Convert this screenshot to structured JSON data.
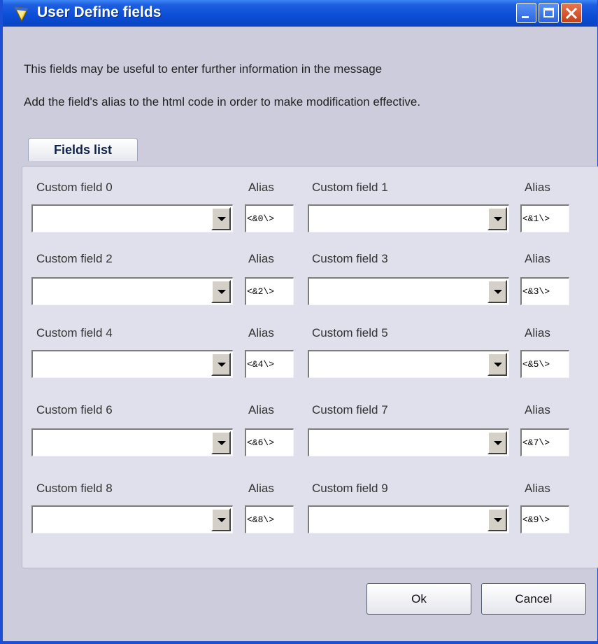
{
  "window": {
    "title": "User Define fields",
    "controls": [
      "minimize-icon",
      "maximize-icon",
      "close-icon"
    ]
  },
  "info": {
    "line1": "This fields may be useful to enter further information in the message",
    "line2": "Add the field's alias to the html code in order to make modification effective."
  },
  "tab": {
    "label": "Fields list"
  },
  "fields": [
    {
      "label": "Custom field 0",
      "alias_label": "Alias",
      "alias": "<&0\\>",
      "value": ""
    },
    {
      "label": "Custom field 1",
      "alias_label": "Alias",
      "alias": "<&1\\>",
      "value": ""
    },
    {
      "label": "Custom field 2",
      "alias_label": "Alias",
      "alias": "<&2\\>",
      "value": ""
    },
    {
      "label": "Custom field 3",
      "alias_label": "Alias",
      "alias": "<&3\\>",
      "value": ""
    },
    {
      "label": "Custom field 4",
      "alias_label": "Alias",
      "alias": "<&4\\>",
      "value": ""
    },
    {
      "label": "Custom field 5",
      "alias_label": "Alias",
      "alias": "<&5\\>",
      "value": ""
    },
    {
      "label": "Custom field 6",
      "alias_label": "Alias",
      "alias": "<&6\\>",
      "value": ""
    },
    {
      "label": "Custom field 7",
      "alias_label": "Alias",
      "alias": "<&7\\>",
      "value": ""
    },
    {
      "label": "Custom field 8",
      "alias_label": "Alias",
      "alias": "<&8\\>",
      "value": ""
    },
    {
      "label": "Custom field 9",
      "alias_label": "Alias",
      "alias": "<&9\\>",
      "value": ""
    }
  ],
  "buttons": {
    "ok": "Ok",
    "cancel": "Cancel"
  },
  "colors": {
    "titlebar": "#0d4fd8",
    "window_bg": "#ccccdc",
    "panel_bg": "#dfe0ec",
    "close_button": "#c2401a"
  }
}
